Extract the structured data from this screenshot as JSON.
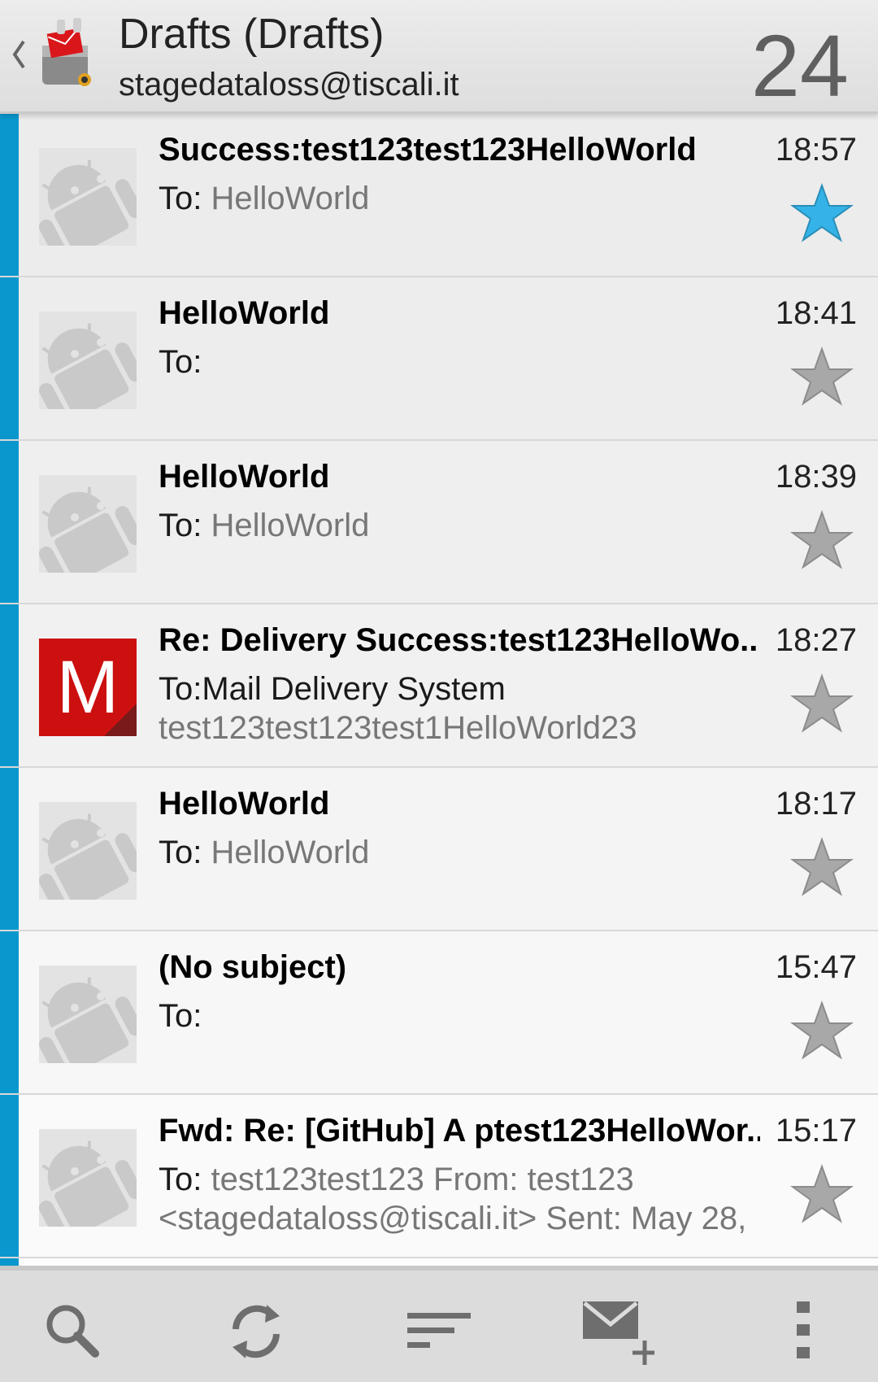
{
  "header": {
    "title": "Drafts (Drafts)",
    "account": "stagedataloss@tiscali.it",
    "count": "24"
  },
  "messages": [
    {
      "subject": "Success:test123test123HelloWorld",
      "time": "18:57",
      "to_label": "To: ",
      "to_value": "HelloWorld",
      "preview": "",
      "starred": true,
      "avatar": "android-avatar"
    },
    {
      "subject": "HelloWorld",
      "time": "18:41",
      "to_label": "To:",
      "to_value": "",
      "preview": "",
      "starred": false,
      "avatar": "android-avatar"
    },
    {
      "subject": "HelloWorld",
      "time": "18:39",
      "to_label": "To: ",
      "to_value": "HelloWorld",
      "preview": "",
      "starred": false,
      "avatar": "android-avatar"
    },
    {
      "subject": "Re: Delivery Success:test123HelloWo..",
      "time": "18:27",
      "to_label": "To:Mail Delivery System",
      "to_value": "",
      "preview": "test123test123test1HelloWorld23",
      "starred": false,
      "avatar": "M"
    },
    {
      "subject": "HelloWorld",
      "time": "18:17",
      "to_label": "To: ",
      "to_value": "HelloWorld",
      "preview": "",
      "starred": false,
      "avatar": "android-avatar"
    },
    {
      "subject": "(No subject)",
      "time": "15:47",
      "to_label": "To:",
      "to_value": "",
      "preview": "",
      "starred": false,
      "avatar": "android-avatar"
    },
    {
      "subject": "Fwd: Re: [GitHub] A ptest123HelloWor..",
      "time": "15:17",
      "to_label": "To: ",
      "to_value": "test123test123 From: test123",
      "preview": "<stagedataloss@tiscali.it> Sent: May 28,",
      "starred": false,
      "avatar": "android-avatar"
    }
  ],
  "toolbar": {
    "icons": [
      "search-icon",
      "refresh-icon",
      "sort-icon",
      "compose-icon",
      "overflow-menu-icon"
    ]
  },
  "colors": {
    "accent_bar": "#0a97cd",
    "star_active": "#35b3e8",
    "star_inactive": "#a8a8a8",
    "m_avatar": "#cc1010"
  }
}
